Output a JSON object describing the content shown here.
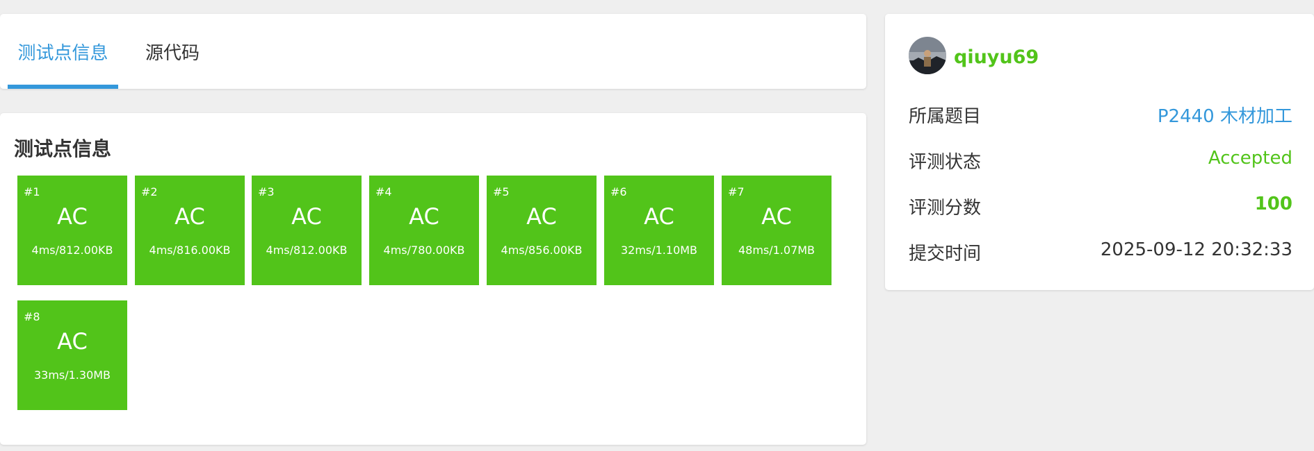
{
  "tabs": [
    {
      "label": "测试点信息"
    },
    {
      "label": "源代码"
    }
  ],
  "tests_panel": {
    "title": "测试点信息",
    "cases": [
      {
        "num": "#1",
        "status": "AC",
        "info": "4ms/812.00KB"
      },
      {
        "num": "#2",
        "status": "AC",
        "info": "4ms/816.00KB"
      },
      {
        "num": "#3",
        "status": "AC",
        "info": "4ms/812.00KB"
      },
      {
        "num": "#4",
        "status": "AC",
        "info": "4ms/780.00KB"
      },
      {
        "num": "#5",
        "status": "AC",
        "info": "4ms/856.00KB"
      },
      {
        "num": "#6",
        "status": "AC",
        "info": "32ms/1.10MB"
      },
      {
        "num": "#7",
        "status": "AC",
        "info": "48ms/1.07MB"
      },
      {
        "num": "#8",
        "status": "AC",
        "info": "33ms/1.30MB"
      }
    ]
  },
  "submission": {
    "username": "qiuyu69",
    "problem_label": "所属题目",
    "problem_value": "P2440 木材加工",
    "status_label": "评测状态",
    "status_value": "Accepted",
    "score_label": "评测分数",
    "score_value": "100",
    "time_label": "提交时间",
    "time_value": "2025-09-12 20:32:33"
  },
  "colors": {
    "accent_blue": "#3498db",
    "accepted_green": "#52c41a",
    "page_bg": "#efefef"
  }
}
